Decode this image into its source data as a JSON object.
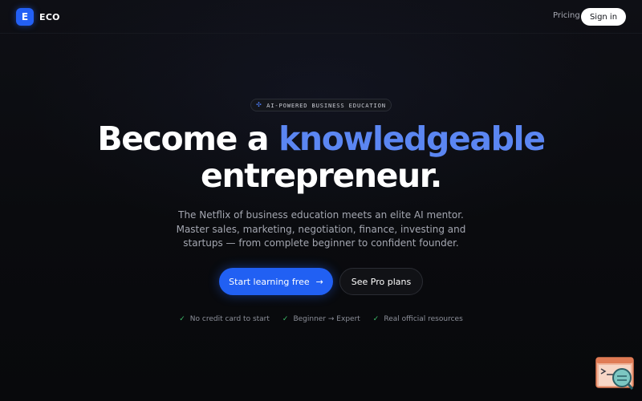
{
  "brand": {
    "logo_letter": "E",
    "name": "ECO",
    "accent_color": "#2360f5"
  },
  "nav": {
    "pricing": "Pricing",
    "signin": "Sign in"
  },
  "hero": {
    "badge_icon": "sparkle-icon",
    "badge": "AI-POWERED BUSINESS EDUCATION",
    "headline_part1": "Become a ",
    "headline_accent": "knowledgeable",
    "headline_part2": "entrepreneur.",
    "subtitle": "The Netflix of business education meets an elite AI mentor. Master sales, marketing, negotiation, finance, investing and startups — from complete beginner to confident founder.",
    "cta_primary": "Start learning free",
    "cta_primary_icon": "arrow-right-icon",
    "cta_secondary": "See Pro plans",
    "perks": [
      "No credit card to start",
      "Beginner → Expert",
      "Real official resources"
    ]
  },
  "widget": {
    "icon": "terminal-search-icon"
  }
}
